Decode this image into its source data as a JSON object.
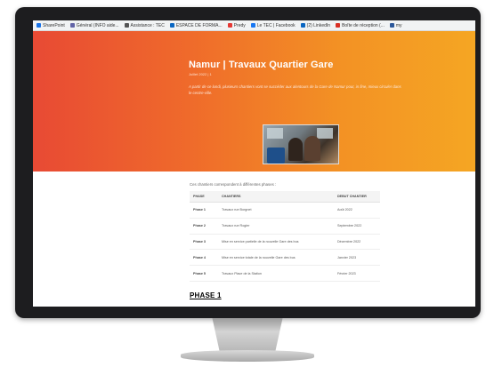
{
  "bookmarks": [
    {
      "label": "SharePoint",
      "color": "#1a73e8"
    },
    {
      "label": "Général (INFO aide...",
      "color": "#6264a7"
    },
    {
      "label": "Assistance : TEC",
      "color": "#555555"
    },
    {
      "label": "ESPACE DE FORMA...",
      "color": "#0a66c2"
    },
    {
      "label": "Predy",
      "color": "#e53935"
    },
    {
      "label": "Le TEC | Facebook",
      "color": "#1877f2"
    },
    {
      "label": "(2) LinkedIn",
      "color": "#0a66c2"
    },
    {
      "label": "Boîte de réception (...",
      "color": "#d93025"
    },
    {
      "label": "my",
      "color": "#2b579a"
    }
  ],
  "hero": {
    "title": "Namur | Travaux Quartier Gare",
    "meta": "Juillet 2022   |   1",
    "description": "A partir de ce lundi, plusieurs chantiers vont se succéder aux alentours de la Gare de Namur pour, in fine, mieux circuler dans le centre-ville."
  },
  "intro": "Ces chantiers correspondent à différentes phases :",
  "table": {
    "headers": [
      "PHASE",
      "CHANTIERS",
      "DEBUT CHANTIER"
    ],
    "rows": [
      [
        "Phase 1",
        "Travaux rue Borgnet",
        "Août 2022"
      ],
      [
        "Phase 2",
        "Travaux rue Rogier",
        "Septembre 2022"
      ],
      [
        "Phase 3",
        "Mise en service partielle de la nouvelle Gare des bus",
        "Décembre 2022"
      ],
      [
        "Phase 4",
        "Mise en service totale de la nouvelle Gare des bus",
        "Janvier 2023"
      ],
      [
        "Phase 5",
        "Travaux Place de la Station",
        "Février 2023"
      ]
    ]
  },
  "phase_heading": "PHASE 1",
  "taskbar": {
    "icons": [
      {
        "name": "windows-icon",
        "color": "#3a9bdc"
      },
      {
        "name": "search-icon",
        "color": "#d9d9d9"
      },
      {
        "name": "chrome-icon",
        "color": "#f4b400"
      },
      {
        "name": "edge-icon",
        "color": "#1fa0e3"
      },
      {
        "name": "outlook-icon",
        "color": "#0f6cbd"
      },
      {
        "name": "file-explorer-icon",
        "color": "#f5c542"
      },
      {
        "name": "excel-icon",
        "color": "#1d6f42"
      },
      {
        "name": "teams-icon",
        "color": "#6264a7"
      },
      {
        "name": "spotify-icon",
        "color": "#1db954"
      },
      {
        "name": "firefox-icon",
        "color": "#ff7139"
      },
      {
        "name": "photos-icon",
        "color": "#2d89ef"
      }
    ]
  }
}
